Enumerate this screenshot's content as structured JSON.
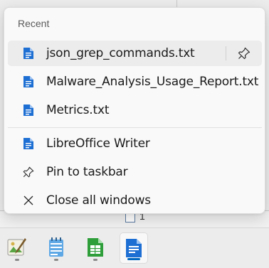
{
  "jumplist": {
    "section_header": "Recent",
    "recent_items": [
      {
        "label": "json_grep_commands.txt",
        "icon": "libreoffice-writer-doc-icon"
      },
      {
        "label": "Malware_Analysis_Usage_Report.txt",
        "icon": "libreoffice-writer-doc-icon"
      },
      {
        "label": "Metrics.txt",
        "icon": "libreoffice-writer-doc-icon"
      }
    ],
    "tasks": [
      {
        "label": "LibreOffice Writer",
        "icon": "libreoffice-writer-icon"
      },
      {
        "label": "Pin to taskbar",
        "icon": "pin-icon"
      },
      {
        "label": "Close all windows",
        "icon": "close-icon"
      }
    ]
  },
  "background_window": {
    "fragment_text": "1"
  },
  "taskbar": {
    "apps": [
      {
        "name": "image-editor",
        "icon": "image-editor-icon",
        "active": false
      },
      {
        "name": "notepad",
        "icon": "notepad-icon",
        "active": false
      },
      {
        "name": "libreoffice-calc",
        "icon": "libreoffice-calc-icon",
        "active": false
      },
      {
        "name": "libreoffice-writer",
        "icon": "libreoffice-writer-icon",
        "active": true
      }
    ]
  },
  "colors": {
    "writer_blue": "#1e6fd3",
    "calc_green": "#2e9e3a",
    "accent": "#0067c0"
  }
}
